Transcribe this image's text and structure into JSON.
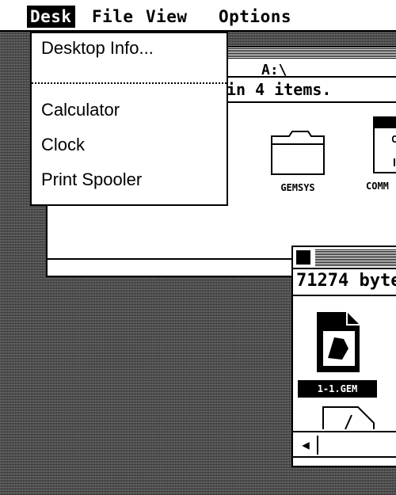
{
  "menu_bar": {
    "items": [
      "Desk",
      "File",
      "View",
      "Options"
    ],
    "active": "Desk"
  },
  "desk_menu": {
    "items": [
      "Desktop Info...",
      "Calculator",
      "Clock",
      "Print Spooler"
    ]
  },
  "window_main": {
    "title": "A:\\",
    "info": "in 4 items.",
    "icons": [
      {
        "label": "GEMSYS",
        "icon": "folder-icon"
      },
      {
        "label": "COMM",
        "icon": "document-icon"
      }
    ]
  },
  "window_second": {
    "info": "71274 byte",
    "selected_icon_label": "1-1.GEM"
  }
}
